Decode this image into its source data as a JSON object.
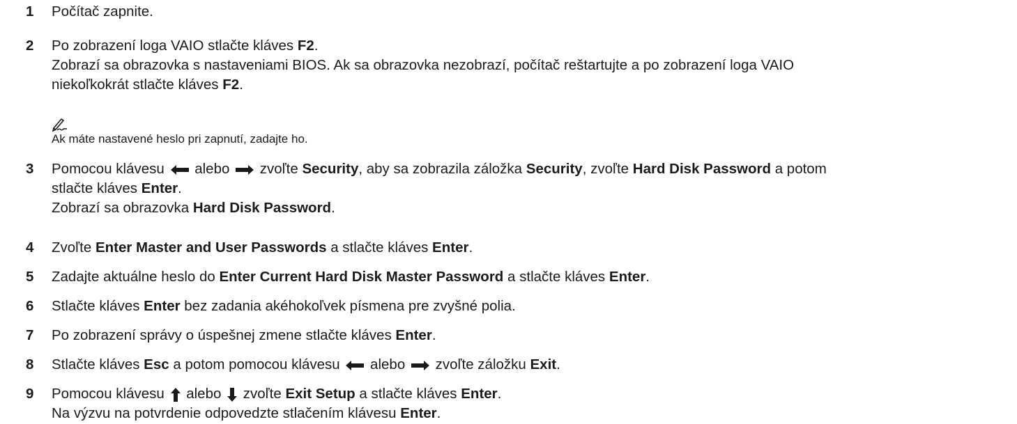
{
  "steps": [
    {
      "number": "1",
      "lines": [
        [
          {
            "t": "Počítač zapnite."
          }
        ]
      ]
    },
    {
      "number": "2",
      "lines": [
        [
          {
            "t": "Po zobrazení loga VAIO stlačte kláves "
          },
          {
            "t": "F2",
            "b": true
          },
          {
            "t": "."
          }
        ],
        [
          {
            "t": "Zobrazí sa obrazovka s nastaveniami BIOS. Ak sa obrazovka nezobrazí, počítač reštartujte a po zobrazení loga VAIO"
          }
        ],
        [
          {
            "t": "niekoľkokrát stlačte kláves "
          },
          {
            "t": "F2",
            "b": true
          },
          {
            "t": "."
          }
        ]
      ]
    },
    {
      "number": "3",
      "lines": [
        [
          {
            "t": "Pomocou klávesu "
          },
          {
            "icon": "left-arrow-icon"
          },
          {
            "t": " alebo "
          },
          {
            "icon": "right-arrow-icon"
          },
          {
            "t": " zvoľte "
          },
          {
            "t": "Security",
            "b": true
          },
          {
            "t": ", aby sa zobrazila záložka "
          },
          {
            "t": "Security",
            "b": true
          },
          {
            "t": ", zvoľte "
          },
          {
            "t": "Hard Disk Password",
            "b": true
          },
          {
            "t": " a potom"
          }
        ],
        [
          {
            "t": "stlačte kláves "
          },
          {
            "t": "Enter",
            "b": true
          },
          {
            "t": "."
          }
        ],
        [
          {
            "t": "Zobrazí sa obrazovka "
          },
          {
            "t": "Hard Disk Password",
            "b": true
          },
          {
            "t": "."
          }
        ]
      ]
    },
    {
      "number": "4",
      "lines": [
        [
          {
            "t": "Zvoľte "
          },
          {
            "t": "Enter Master and User Passwords",
            "b": true
          },
          {
            "t": " a stlačte kláves "
          },
          {
            "t": "Enter",
            "b": true
          },
          {
            "t": "."
          }
        ]
      ]
    },
    {
      "number": "5",
      "lines": [
        [
          {
            "t": "Zadajte aktuálne heslo do "
          },
          {
            "t": "Enter Current Hard Disk Master Password",
            "b": true
          },
          {
            "t": " a stlačte kláves "
          },
          {
            "t": "Enter",
            "b": true
          },
          {
            "t": "."
          }
        ]
      ]
    },
    {
      "number": "6",
      "lines": [
        [
          {
            "t": "Stlačte kláves "
          },
          {
            "t": "Enter",
            "b": true
          },
          {
            "t": " bez zadania akéhokoľvek písmena pre zvyšné polia."
          }
        ]
      ]
    },
    {
      "number": "7",
      "lines": [
        [
          {
            "t": "Po zobrazení správy o úspešnej zmene stlačte kláves "
          },
          {
            "t": "Enter",
            "b": true
          },
          {
            "t": "."
          }
        ]
      ]
    },
    {
      "number": "8",
      "lines": [
        [
          {
            "t": "Stlačte kláves "
          },
          {
            "t": "Esc",
            "b": true
          },
          {
            "t": " a potom pomocou klávesu "
          },
          {
            "icon": "left-arrow-icon"
          },
          {
            "t": " alebo "
          },
          {
            "icon": "right-arrow-icon"
          },
          {
            "t": " zvoľte záložku "
          },
          {
            "t": "Exit",
            "b": true
          },
          {
            "t": "."
          }
        ]
      ]
    },
    {
      "number": "9",
      "lines": [
        [
          {
            "t": "Pomocou klávesu "
          },
          {
            "icon": "up-arrow-icon"
          },
          {
            "t": " alebo "
          },
          {
            "icon": "down-arrow-icon"
          },
          {
            "t": " zvoľte "
          },
          {
            "t": "Exit Setup",
            "b": true
          },
          {
            "t": " a stlačte kláves "
          },
          {
            "t": "Enter",
            "b": true
          },
          {
            "t": "."
          }
        ],
        [
          {
            "t": "Na výzvu na potvrdenie odpovedzte stlačením klávesu "
          },
          {
            "t": "Enter",
            "b": true
          },
          {
            "t": "."
          }
        ]
      ]
    }
  ],
  "note": {
    "icon": "pencil-note-icon",
    "text": "Ak máte nastavené heslo pri zapnutí, zadajte ho."
  },
  "colors": {
    "text": "#1a1a1a",
    "note_icon": "#1a1a1a"
  }
}
